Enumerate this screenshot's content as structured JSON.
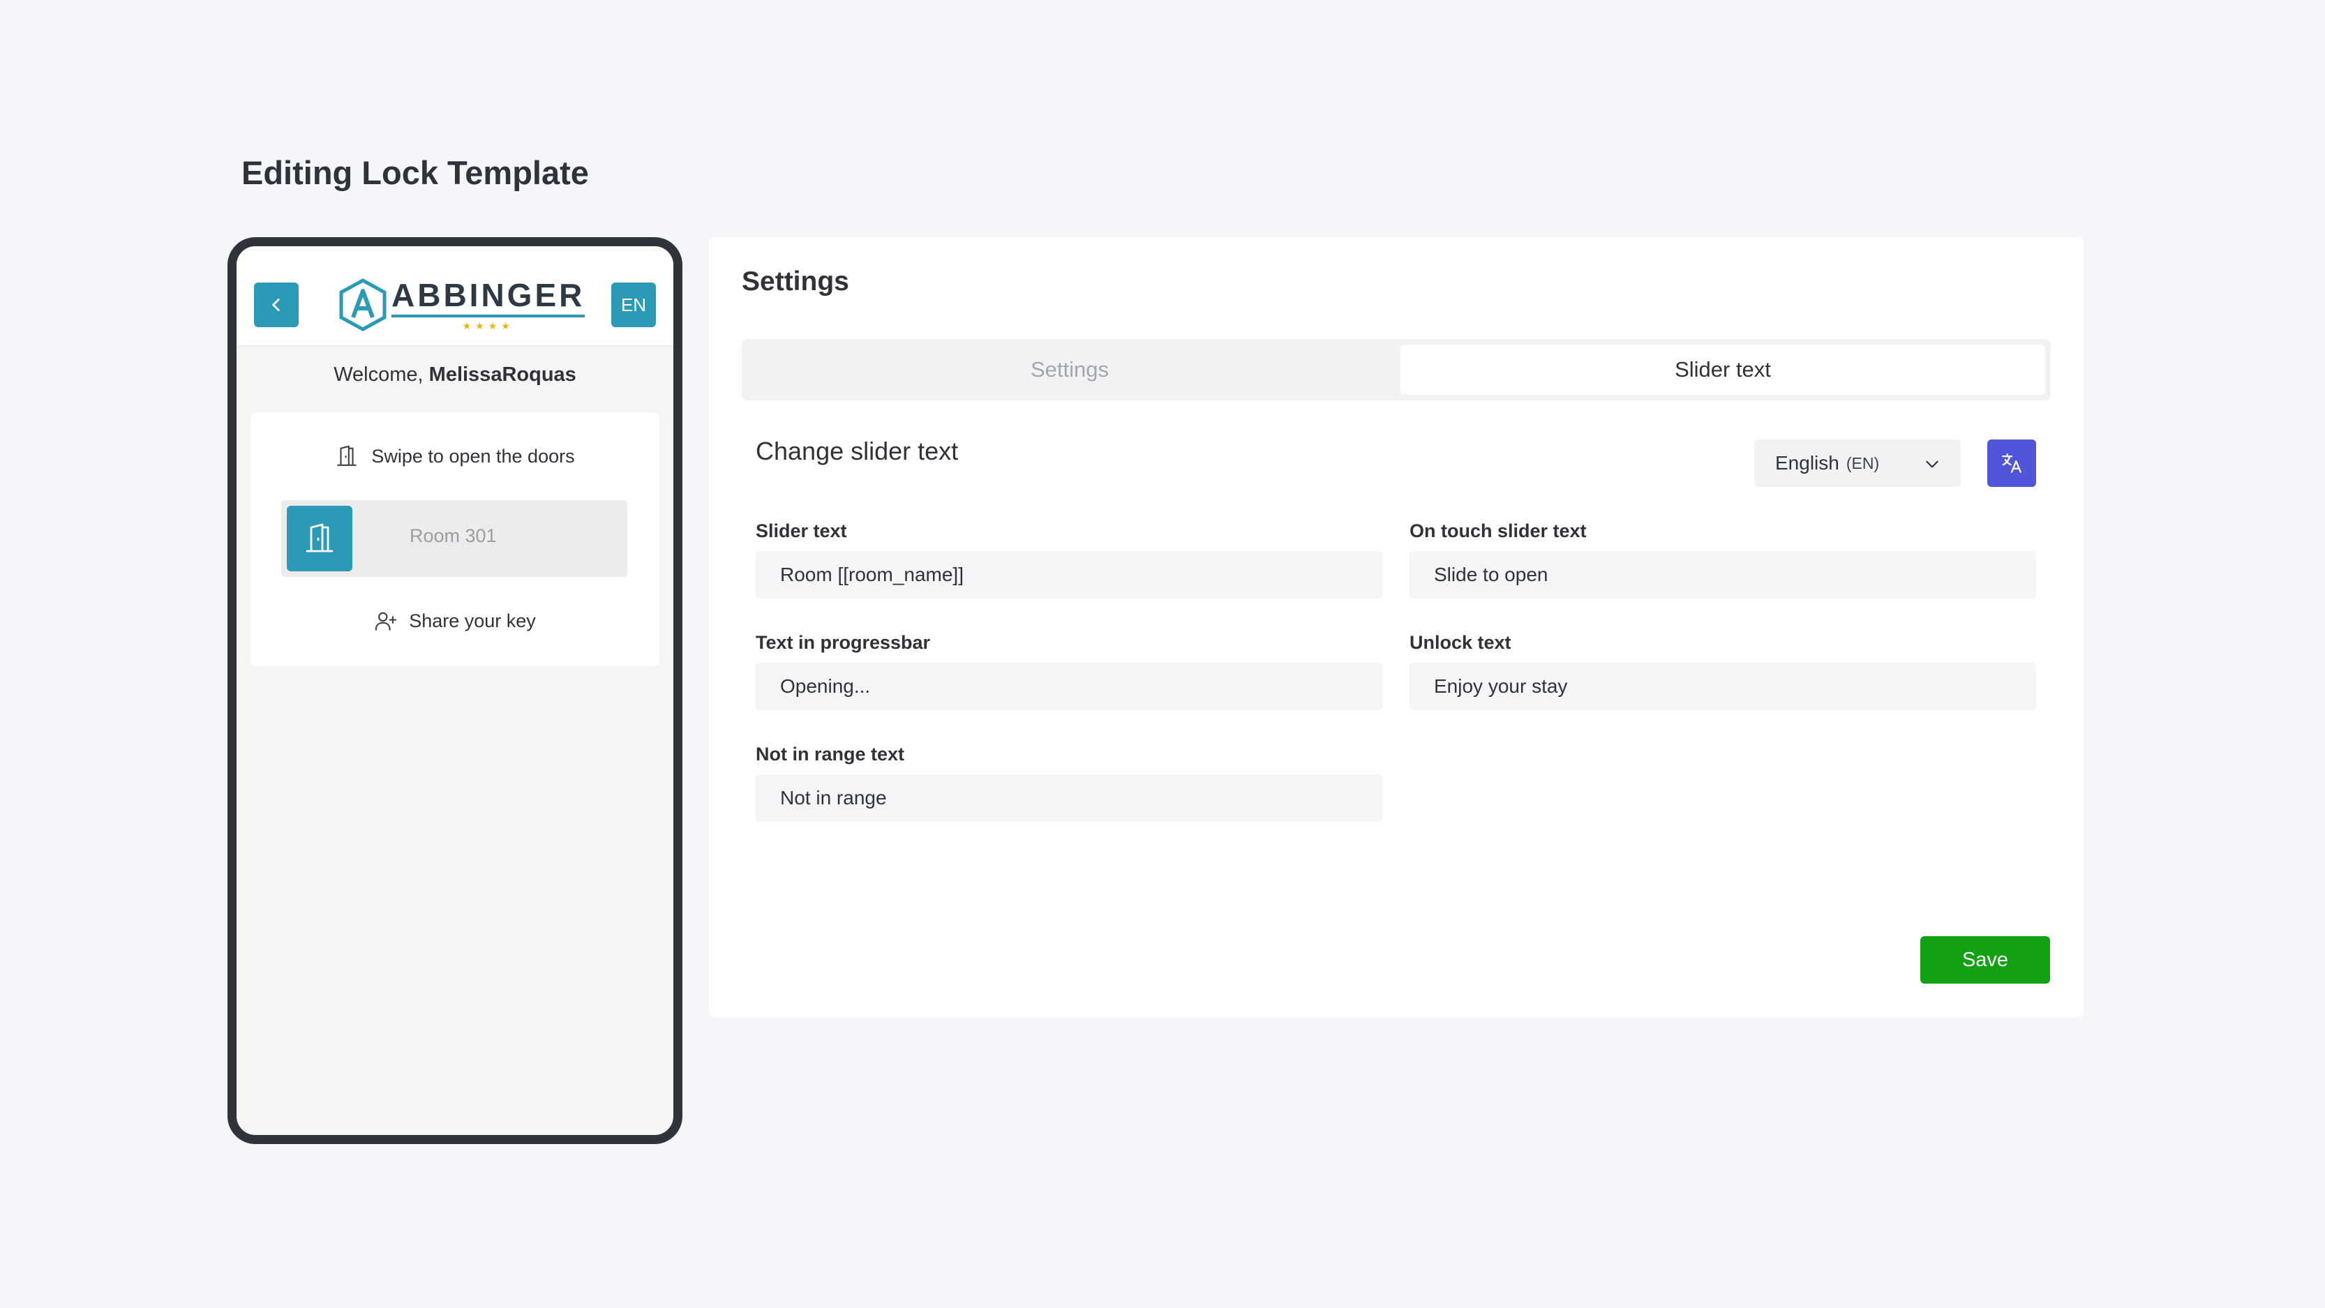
{
  "page": {
    "title": "Editing Lock Template"
  },
  "phone": {
    "brand": "ABBINGER",
    "brand_stars": "★★★★",
    "lang_button": "EN",
    "welcome_prefix": "Welcome, ",
    "username": "MelissaRoquas",
    "swipe_text": "Swipe to open the doors",
    "slider_label": "Room 301",
    "share_text": "Share your key"
  },
  "panel": {
    "title": "Settings",
    "tabs": [
      {
        "label": "Settings",
        "active": false
      },
      {
        "label": "Slider text",
        "active": true
      }
    ],
    "section_title": "Change slider text",
    "language": {
      "label": "English",
      "code": "(EN)"
    },
    "fields": {
      "slider_text": {
        "label": "Slider text",
        "value": "Room [[room_name]]"
      },
      "on_touch_slider_text": {
        "label": "On touch slider text",
        "value": "Slide to open"
      },
      "progressbar_text": {
        "label": "Text in progressbar",
        "value": "Opening..."
      },
      "unlock_text": {
        "label": "Unlock text",
        "value": "Enjoy your stay"
      },
      "not_in_range_text": {
        "label": "Not in range text",
        "value": "Not in range"
      }
    },
    "save_label": "Save"
  },
  "colors": {
    "accent": "#2b9ab6",
    "translate": "#5155d9",
    "save": "#12a112",
    "background": "#f4f6f9",
    "stars": "#f2b40b"
  },
  "icons": [
    "chevron-left-icon",
    "hexagon-a-logo-icon",
    "door-icon",
    "door-open-icon",
    "user-plus-icon",
    "chevron-down-icon",
    "translate-icon"
  ]
}
